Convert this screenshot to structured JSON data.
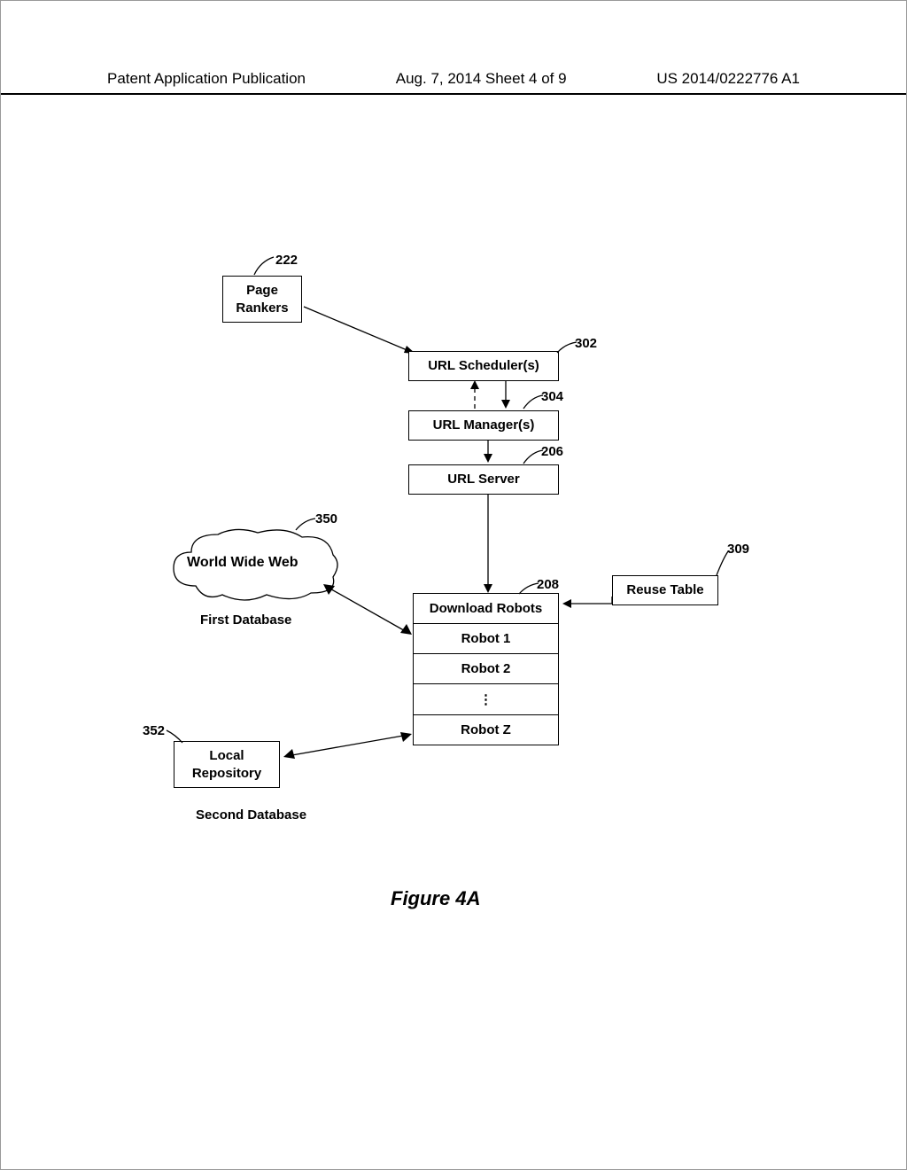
{
  "header": {
    "left": "Patent Application Publication",
    "center": "Aug. 7, 2014  Sheet 4 of 9",
    "right": "US 2014/0222776 A1"
  },
  "refs": {
    "page_rankers": "222",
    "url_schedulers": "302",
    "url_managers": "304",
    "url_server": "206",
    "world_wide_web": "350",
    "download_robots": "208",
    "reuse_table": "309",
    "local_repository": "352"
  },
  "boxes": {
    "page_rankers": "Page\nRankers",
    "url_schedulers": "URL Scheduler(s)",
    "url_managers": "URL Manager(s)",
    "url_server": "URL Server",
    "download_robots_head": "Download Robots",
    "robot1": "Robot 1",
    "robot2": "Robot 2",
    "robot_dots": "⋮",
    "robotz": "Robot Z",
    "reuse_table": "Reuse Table",
    "local_repository": "Local\nRepository",
    "world_wide_web": "World Wide Web"
  },
  "labels": {
    "first_database": "First Database",
    "second_database": "Second Database"
  },
  "figure_caption": "Figure 4A"
}
